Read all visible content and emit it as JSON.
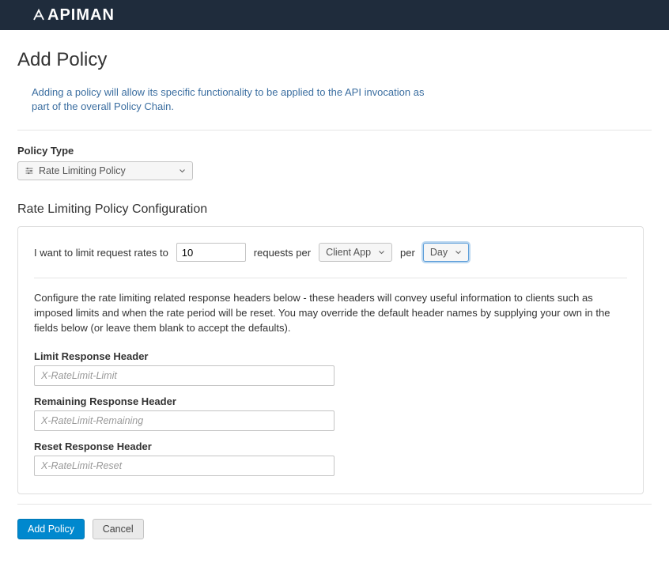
{
  "brand": "APIMAN",
  "page": {
    "title": "Add Policy",
    "description": "Adding a policy will allow its specific functionality to be applied to the API invocation as part of the overall Policy Chain."
  },
  "policyType": {
    "label": "Policy Type",
    "selected": "Rate Limiting Policy"
  },
  "config": {
    "sectionTitle": "Rate Limiting Policy Configuration",
    "rateLine": {
      "prefix": "I want to limit request rates to",
      "value": "10",
      "mid1": "requests per",
      "granularity": "Client App",
      "mid2": "per",
      "period": "Day"
    },
    "headersDesc": "Configure the rate limiting related response headers below - these headers will convey useful information to clients such as imposed limits and when the rate period will be reset. You may override the default header names by supplying your own in the fields below (or leave them blank to accept the defaults).",
    "limitHeader": {
      "label": "Limit Response Header",
      "placeholder": "X-RateLimit-Limit",
      "value": ""
    },
    "remainingHeader": {
      "label": "Remaining Response Header",
      "placeholder": "X-RateLimit-Remaining",
      "value": ""
    },
    "resetHeader": {
      "label": "Reset Response Header",
      "placeholder": "X-RateLimit-Reset",
      "value": ""
    }
  },
  "buttons": {
    "add": "Add Policy",
    "cancel": "Cancel"
  }
}
